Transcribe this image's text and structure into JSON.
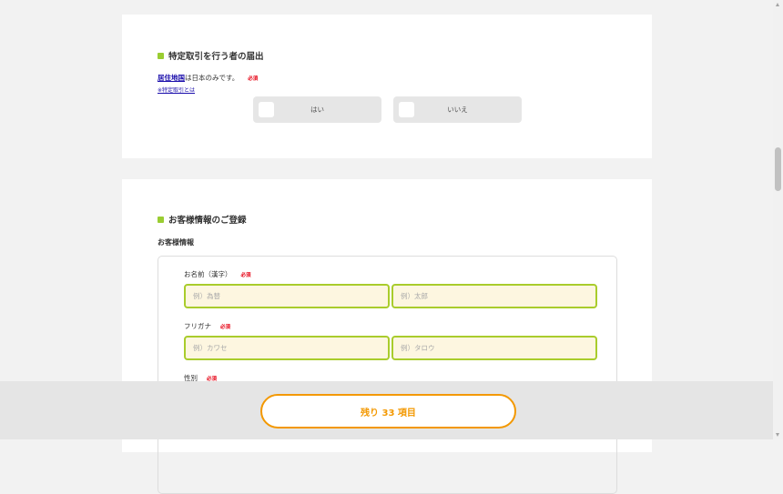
{
  "section1": {
    "title": "特定取引を行う者の届出",
    "note_link": "居住地国",
    "note_text": "は日本のみです。",
    "required": "必須",
    "sub_link": "※特定取引とは",
    "yes_label": "はい",
    "no_label": "いいえ"
  },
  "section2": {
    "title": "お客様情報のご登録",
    "subheading": "お客様情報",
    "name_label": "お名前（漢字）",
    "name_required": "必須",
    "name_last_placeholder": "例）為替",
    "name_first_placeholder": "例）太郎",
    "kana_label": "フリガナ",
    "kana_required": "必須",
    "kana_last_placeholder": "例）カワセ",
    "kana_first_placeholder": "例）タロウ",
    "gender_label": "性別",
    "gender_required": "必須"
  },
  "footer": {
    "remaining_label": "残り 33 項目"
  },
  "colors": {
    "accent_green": "#9acd32",
    "input_border": "#a9cc2c",
    "input_bg": "#fdf6e0",
    "required_red": "#e60012",
    "cta_orange": "#f39800",
    "link_blue": "#1a0dab"
  }
}
